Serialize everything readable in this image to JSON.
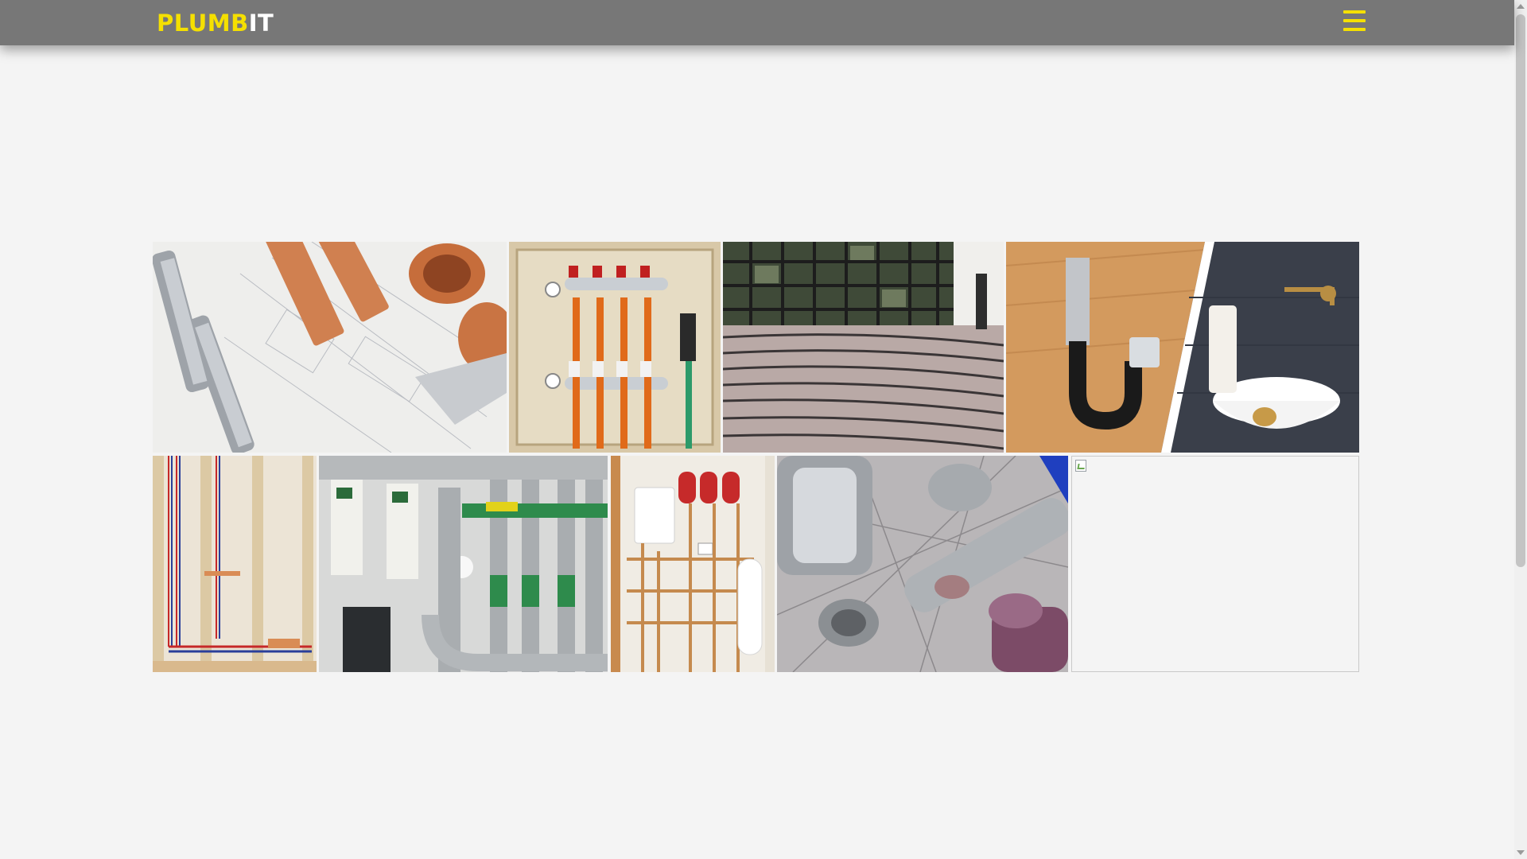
{
  "header": {
    "logo_part1": "PLUMB",
    "logo_part2": "IT",
    "logo_accent_color": "#f5e000",
    "bar_color": "#777777",
    "menu_icon": "hamburger-menu-icon"
  },
  "gallery": {
    "images": [
      {
        "name": "image-copper-pipes-blueprint"
      },
      {
        "name": "image-heating-manifold"
      },
      {
        "name": "image-underfloor-heating"
      },
      {
        "name": "image-sink-trap-basin"
      },
      {
        "name": "image-wall-pipework"
      },
      {
        "name": "image-plant-room"
      },
      {
        "name": "image-boiler-cupboard"
      },
      {
        "name": "image-pipe-fittings"
      },
      {
        "name": "image-broken"
      }
    ]
  }
}
